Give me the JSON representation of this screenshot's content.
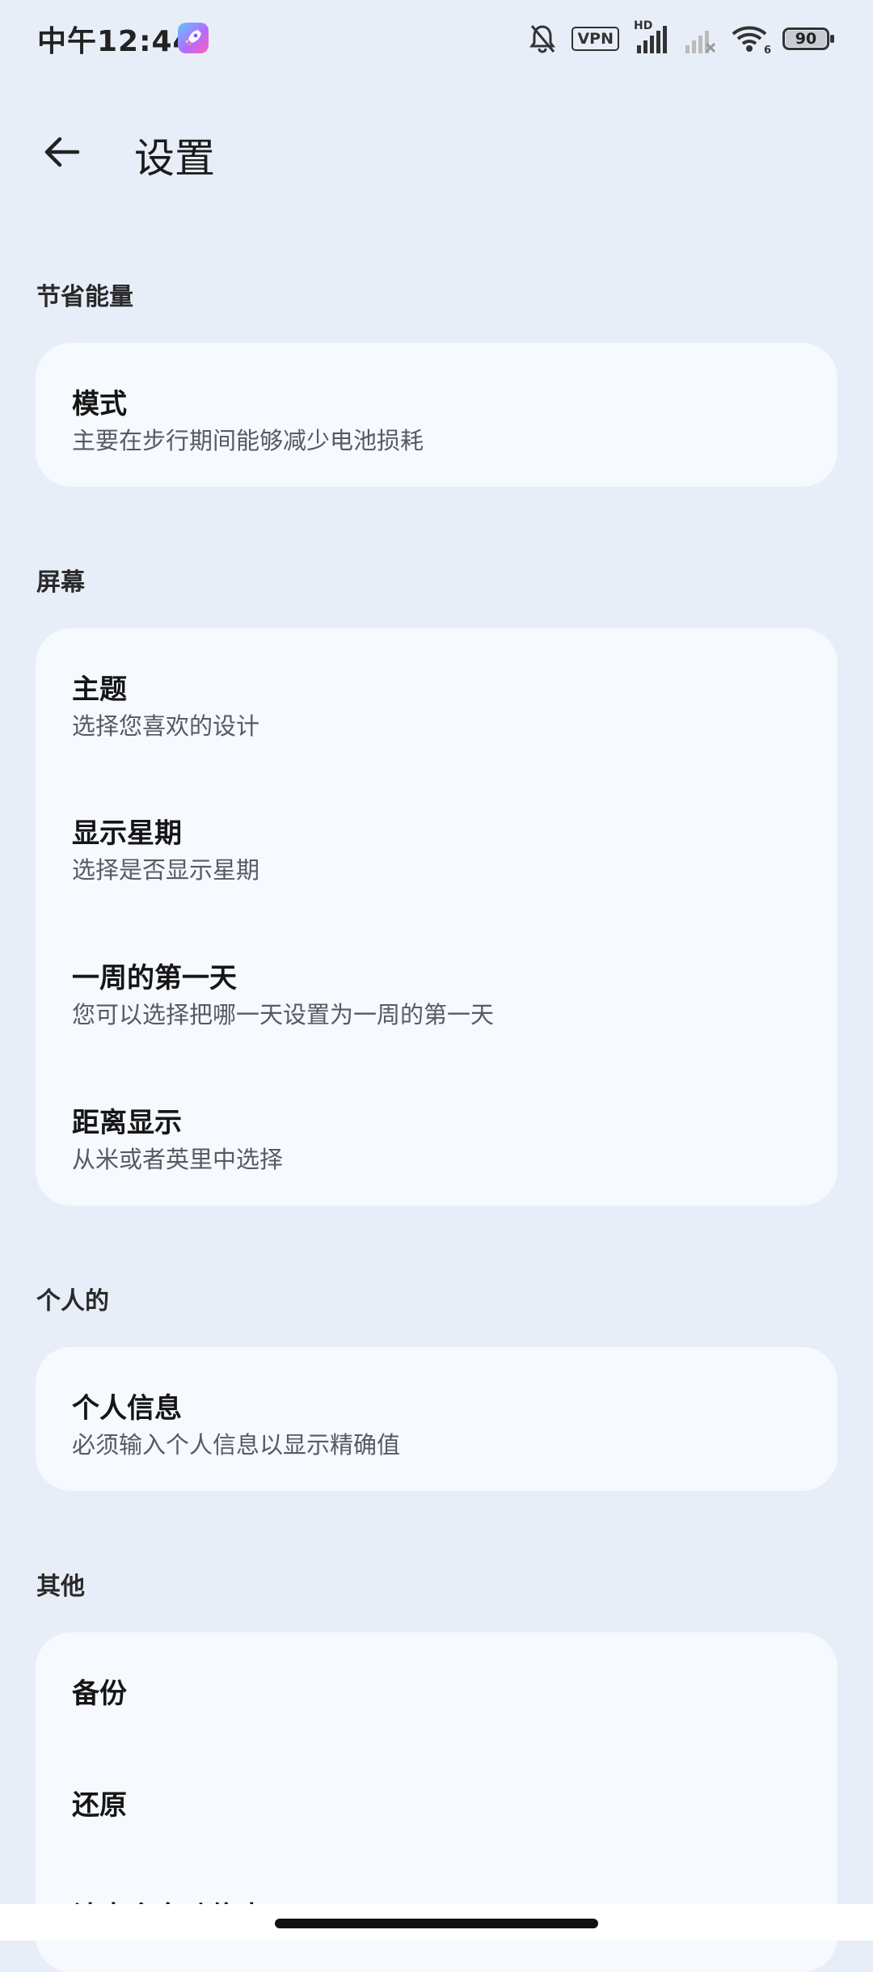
{
  "status_bar": {
    "time": "中午12:44",
    "vpn": "VPN",
    "hd": "HD",
    "wifi_sub": "6",
    "battery": "90"
  },
  "header": {
    "title": "设置"
  },
  "sections": [
    {
      "label": "节省能量",
      "items": [
        {
          "title": "模式",
          "subtitle": "主要在步行期间能够减少电池损耗"
        }
      ]
    },
    {
      "label": "屏幕",
      "items": [
        {
          "title": "主题",
          "subtitle": "选择您喜欢的设计"
        },
        {
          "title": "显示星期",
          "subtitle": "选择是否显示星期"
        },
        {
          "title": "一周的第一天",
          "subtitle": "您可以选择把哪一天设置为一周的第一天"
        },
        {
          "title": "距离显示",
          "subtitle": "从米或者英里中选择"
        }
      ]
    },
    {
      "label": "个人的",
      "items": [
        {
          "title": "个人信息",
          "subtitle": "必须输入个人信息以显示精确值"
        }
      ]
    },
    {
      "label": "其他",
      "items": [
        {
          "title": "备份"
        },
        {
          "title": "还原"
        },
        {
          "title": "计步会自动停止"
        }
      ]
    }
  ],
  "colors": {
    "background": "#E8EEF8",
    "card": "#F6F9FE",
    "text_primary": "#151515",
    "text_secondary": "#555B63"
  }
}
